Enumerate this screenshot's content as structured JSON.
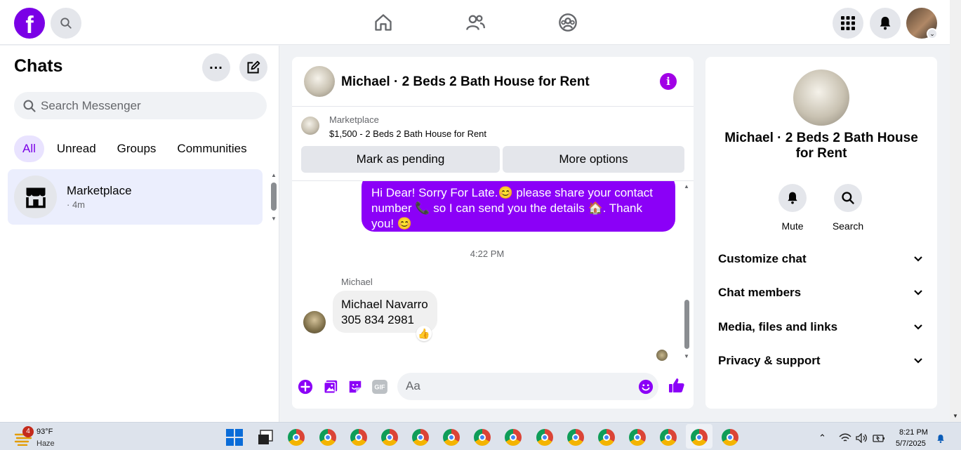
{
  "topbar": {
    "logo": "f",
    "icons": [
      "search-icon",
      "home-icon",
      "friends-icon",
      "groups-icon",
      "menu-grid-icon",
      "bell-icon"
    ]
  },
  "sidebar": {
    "title": "Chats",
    "search_placeholder": "Search Messenger",
    "filters": [
      "All",
      "Unread",
      "Groups",
      "Communities"
    ],
    "active_filter": "All",
    "threads": [
      {
        "name": "Marketplace",
        "meta": "· 4m",
        "icon": "store-icon"
      }
    ]
  },
  "conversation": {
    "title": "Michael · 2 Beds 2 Bath House for Rent",
    "marketplace_label": "Marketplace",
    "listing": "$1,500 - 2 Beds 2 Bath House for Rent",
    "buttons": {
      "pending": "Mark as pending",
      "more": "More options"
    },
    "messages": {
      "outgoing": "Hi Dear! Sorry For Late.😊 please share your contact number 📞 so I can send you the details 🏠. Thank you! 😊",
      "time": "4:22 PM",
      "sender": "Michael",
      "incoming_line1": "Michael Navarro",
      "incoming_line2": "305 834 2981",
      "reaction": "👍"
    },
    "composer_placeholder": "Aa",
    "composer_icons": [
      "plus-icon",
      "photo-icon",
      "sticker-icon",
      "gif-icon",
      "emoji-icon",
      "thumbs-up-icon"
    ]
  },
  "info_panel": {
    "title": "Michael · 2 Beds 2 Bath House for Rent",
    "actions": [
      {
        "label": "Mute",
        "icon": "bell-icon"
      },
      {
        "label": "Search",
        "icon": "search-icon"
      }
    ],
    "sections": [
      "Customize chat",
      "Chat members",
      "Media, files and links",
      "Privacy & support"
    ]
  },
  "taskbar": {
    "weather_badge": "4",
    "temperature": "93°F",
    "condition": "Haze",
    "time": "8:21 PM",
    "date": "5/7/2025"
  },
  "colors": {
    "accent": "#8b00f7",
    "brand": "#7a00e6",
    "active_thread": "#ebeefd"
  }
}
